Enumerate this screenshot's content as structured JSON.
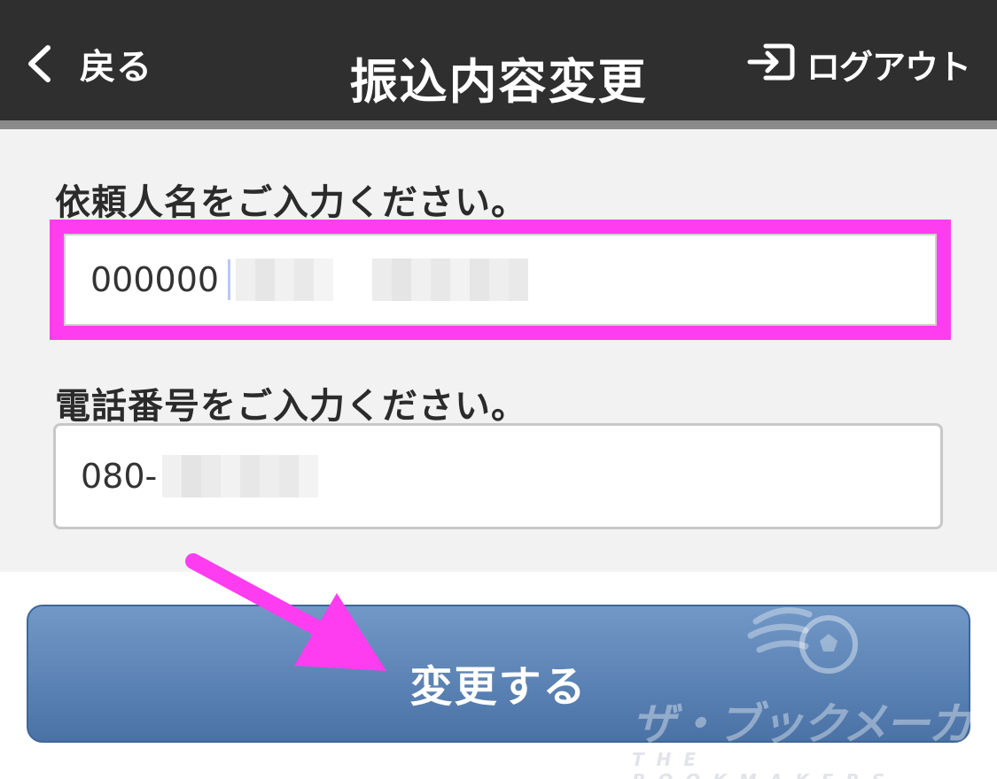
{
  "header": {
    "back_label": "戻る",
    "title": "振込内容変更",
    "logout_label": "ログアウト",
    "icons": {
      "back": "chevron-left-icon",
      "logout": "logout-icon"
    }
  },
  "form": {
    "name_label": "依頼人名をご入力ください。",
    "name_value": "000000",
    "phone_label": "電話番号をご入力ください。",
    "phone_value": "080-"
  },
  "submit": {
    "label": "変更する"
  },
  "watermark": {
    "jp": "ザ・ブックメーカーズ",
    "en": "THE BOOKMAKERS"
  },
  "colors": {
    "header_bg": "#2f2f2f",
    "form_bg": "#f2f2f2",
    "highlight": "#ff3df0",
    "button_top": "#7198c6",
    "button_bottom": "#4a72a6"
  }
}
